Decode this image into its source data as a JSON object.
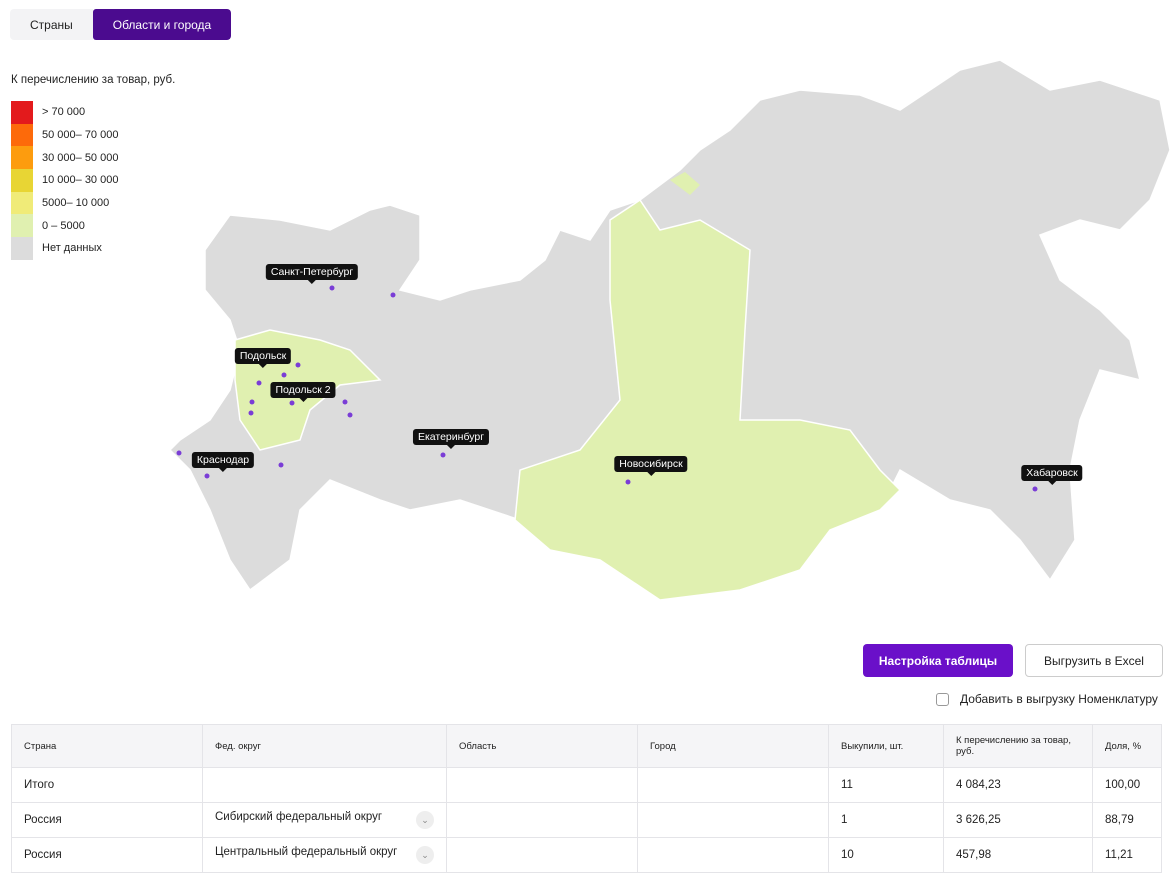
{
  "tabs": [
    {
      "label": "Страны",
      "active": false
    },
    {
      "label": "Области и города",
      "active": true
    }
  ],
  "legend": {
    "title": "К перечислению за товар, руб.",
    "items": [
      {
        "label": "> 70 000",
        "color": "#e31a1c"
      },
      {
        "label": "50 000– 70 000",
        "color": "#fd6a0a"
      },
      {
        "label": "30 000– 50 000",
        "color": "#fd9c0e"
      },
      {
        "label": "10 000– 30 000",
        "color": "#e8d534"
      },
      {
        "label": "5000– 10 000",
        "color": "#f0eb78"
      },
      {
        "label": "0 – 5000",
        "color": "#e0f0b0"
      },
      {
        "label": "Нет данных",
        "color": "#dcdcdc"
      }
    ]
  },
  "cities": [
    "Санкт-Петербург",
    "Подольск",
    "Подольск 2",
    "Краснодар",
    "Екатеринбург",
    "Новосибирск",
    "Хабаровск"
  ],
  "buttons": {
    "table_settings": "Настройка таблицы",
    "export_excel": "Выгрузить в Excel"
  },
  "checkbox": {
    "label": "Добавить в выгрузку Номенклатуру",
    "checked": false
  },
  "table": {
    "headers": [
      "Страна",
      "Фед. округ",
      "Область",
      "Город",
      "Выкупили, шт.",
      "К перечислению за товар, руб.",
      "Доля, %"
    ],
    "rows": [
      [
        "Итого",
        "",
        "",
        "",
        "11",
        "4 084,23",
        "100,00"
      ],
      [
        "Россия",
        "Сибирский федеральный округ",
        "",
        "",
        "1",
        "3 626,25",
        "88,79"
      ],
      [
        "Россия",
        "Центральный федеральный округ",
        "",
        "",
        "10",
        "457,98",
        "11,21"
      ]
    ]
  }
}
